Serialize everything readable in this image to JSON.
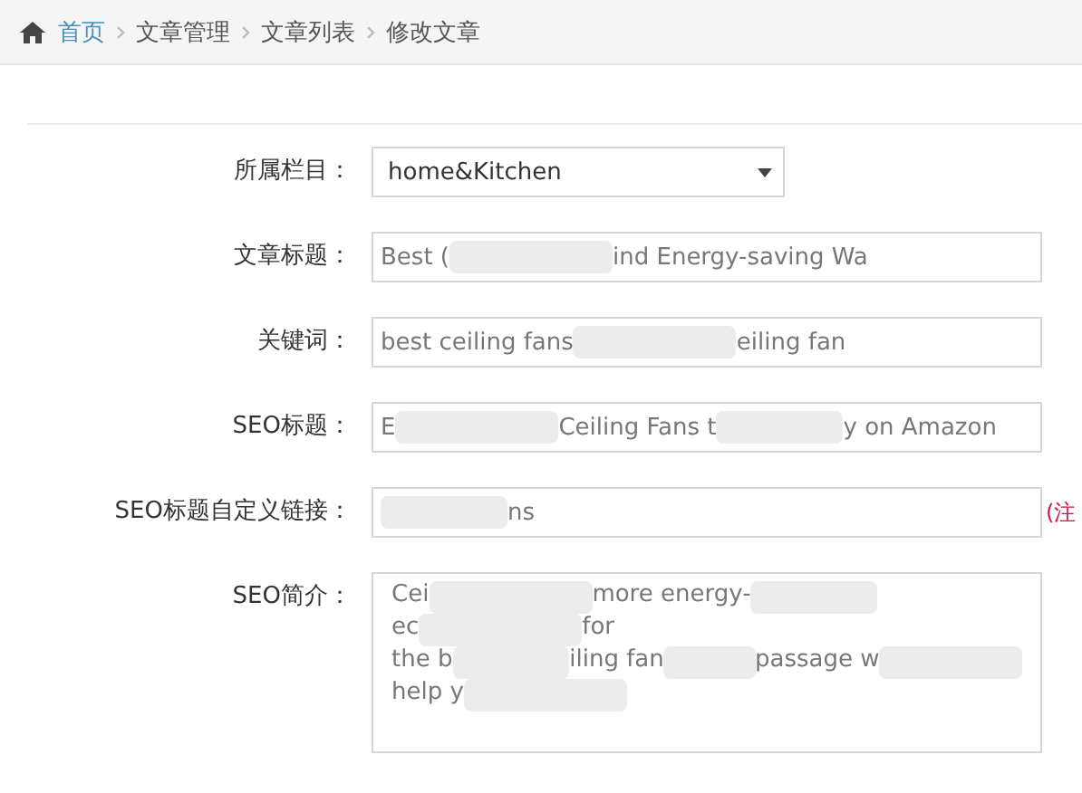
{
  "breadcrumb": [
    {
      "label": "首页",
      "link": true
    },
    {
      "label": "文章管理",
      "link": false
    },
    {
      "label": "文章列表",
      "link": false
    },
    {
      "label": "修改文章",
      "link": false
    }
  ],
  "form": [
    {
      "kind": "select",
      "label": "所属栏目：",
      "value": "home&Kitchen"
    },
    {
      "kind": "input",
      "label": "文章标题：",
      "segments": [
        {
          "kind": "text",
          "text": "Best ("
        },
        {
          "kind": "blur"
        },
        {
          "kind": "text",
          "text": "ind Energy-saving Wa"
        }
      ]
    },
    {
      "kind": "input",
      "label": "关键词：",
      "segments": [
        {
          "kind": "text",
          "text": "best ceiling fans"
        },
        {
          "kind": "blur"
        },
        {
          "kind": "text",
          "text": "eiling fan"
        }
      ]
    },
    {
      "kind": "input",
      "label": "SEO标题：",
      "segments": [
        {
          "kind": "text",
          "text": "E"
        },
        {
          "kind": "blur"
        },
        {
          "kind": "text",
          "text": "Ceiling Fans t"
        },
        {
          "kind": "blur"
        },
        {
          "kind": "text",
          "text": "y on Amazon"
        }
      ]
    },
    {
      "kind": "input",
      "label": "SEO标题自定义链接：",
      "note": "(注",
      "segments": [
        {
          "kind": "blur"
        },
        {
          "kind": "text",
          "text": "ns"
        }
      ]
    },
    {
      "kind": "textarea",
      "label": "SEO简介：",
      "lines": [
        [
          {
            "kind": "text",
            "text": "Cei"
          },
          {
            "kind": "blur"
          },
          {
            "kind": "text",
            "text": "more energy-"
          },
          {
            "kind": "blur"
          }
        ],
        [
          {
            "kind": "text",
            "text": "ec"
          },
          {
            "kind": "blur"
          },
          {
            "kind": "text",
            "text": "for"
          }
        ],
        [
          {
            "kind": "text",
            "text": "the b"
          },
          {
            "kind": "blur"
          },
          {
            "kind": "text",
            "text": "iling fan"
          },
          {
            "kind": "blur"
          },
          {
            "kind": "text",
            "text": "passage w"
          },
          {
            "kind": "blur"
          }
        ],
        [
          {
            "kind": "text",
            "text": "help y"
          },
          {
            "kind": "blur"
          }
        ]
      ]
    }
  ]
}
